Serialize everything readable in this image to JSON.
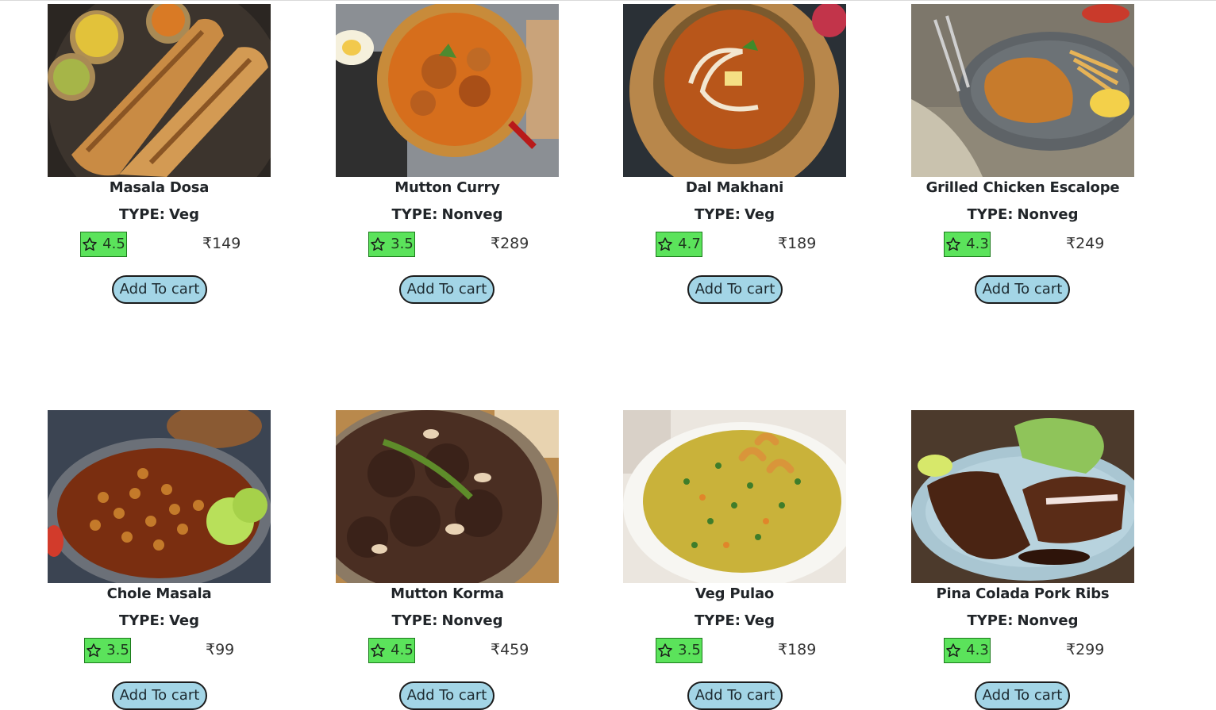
{
  "currency_symbol": "₹",
  "type_label": "TYPE:",
  "button_label": "Add To cart",
  "colors": {
    "rating_bg": "#5be35b",
    "button_bg": "#a3d5e6"
  },
  "items": [
    {
      "name": "Masala Dosa",
      "type": "Veg",
      "rating": "4.5",
      "price": "₹149",
      "image": "masala-dosa-photo"
    },
    {
      "name": "Mutton Curry",
      "type": "Nonveg",
      "rating": "3.5",
      "price": "₹289",
      "image": "mutton-curry-photo"
    },
    {
      "name": "Dal Makhani",
      "type": "Veg",
      "rating": "4.7",
      "price": "₹189",
      "image": "dal-makhani-photo"
    },
    {
      "name": "Grilled Chicken Escalope",
      "type": "Nonveg",
      "rating": "4.3",
      "price": "₹249",
      "image": "grilled-chicken-photo"
    },
    {
      "name": "Chole Masala",
      "type": "Veg",
      "rating": "3.5",
      "price": "₹99",
      "image": "chole-masala-photo"
    },
    {
      "name": "Mutton Korma",
      "type": "Nonveg",
      "rating": "4.5",
      "price": "₹459",
      "image": "mutton-korma-photo"
    },
    {
      "name": "Veg Pulao",
      "type": "Veg",
      "rating": "3.5",
      "price": "₹189",
      "image": "veg-pulao-photo"
    },
    {
      "name": "Pina Colada Pork Ribs",
      "type": "Nonveg",
      "rating": "4.3",
      "price": "₹299",
      "image": "pork-ribs-photo"
    }
  ]
}
